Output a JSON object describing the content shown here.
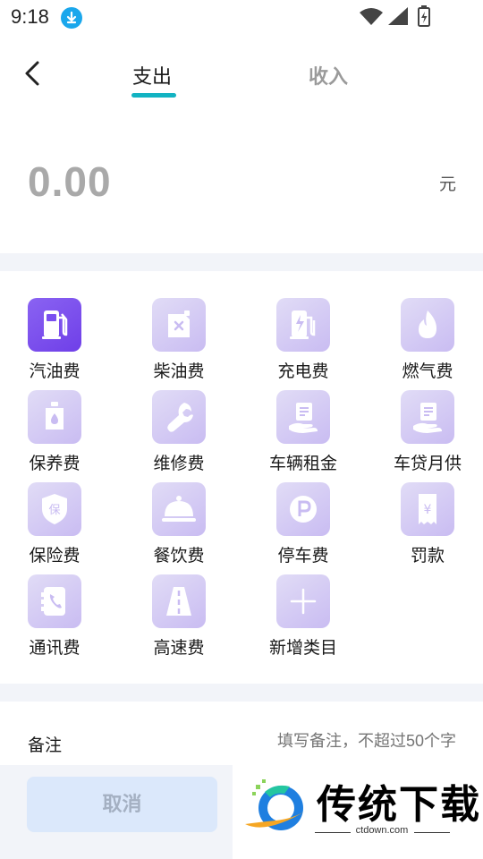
{
  "status_bar": {
    "time": "9:18",
    "icons": [
      "download-icon",
      "wifi-icon",
      "signal-icon",
      "battery-charging-icon"
    ]
  },
  "header": {
    "tabs": [
      {
        "label": "支出",
        "active": true
      },
      {
        "label": "收入",
        "active": false
      }
    ],
    "accent_color": "#12b3c2"
  },
  "amount": {
    "value": "0.00",
    "unit": "元"
  },
  "categories": [
    {
      "label": "汽油费",
      "icon": "gas-pump-icon",
      "selected": true
    },
    {
      "label": "柴油费",
      "icon": "fuel-can-icon",
      "selected": false
    },
    {
      "label": "充电费",
      "icon": "charging-station-icon",
      "selected": false
    },
    {
      "label": "燃气费",
      "icon": "flame-icon",
      "selected": false
    },
    {
      "label": "保养费",
      "icon": "oil-bottle-icon",
      "selected": false
    },
    {
      "label": "维修费",
      "icon": "wrench-icon",
      "selected": false
    },
    {
      "label": "车辆租金",
      "icon": "hand-money-icon",
      "selected": false
    },
    {
      "label": "车贷月供",
      "icon": "hand-money-icon",
      "selected": false
    },
    {
      "label": "保险费",
      "icon": "insurance-shield-icon",
      "selected": false
    },
    {
      "label": "餐饮费",
      "icon": "food-cloche-icon",
      "selected": false
    },
    {
      "label": "停车费",
      "icon": "parking-icon",
      "selected": false
    },
    {
      "label": "罚款",
      "icon": "receipt-yen-icon",
      "selected": false
    },
    {
      "label": "通讯费",
      "icon": "phone-icon",
      "selected": false
    },
    {
      "label": "高速费",
      "icon": "highway-icon",
      "selected": false
    },
    {
      "label": "新增类目",
      "icon": "plus-icon",
      "selected": false
    }
  ],
  "remark": {
    "label": "备注",
    "placeholder": "填写备注，不超过50个字"
  },
  "footer": {
    "cancel_label": "取消"
  },
  "watermark": {
    "text": "传统下载",
    "url": "ctdown.com"
  },
  "colors": {
    "category_active": "#7a4ff0",
    "category_inactive": "#d8d0f5",
    "cancel_bg": "#dbe8fb"
  }
}
